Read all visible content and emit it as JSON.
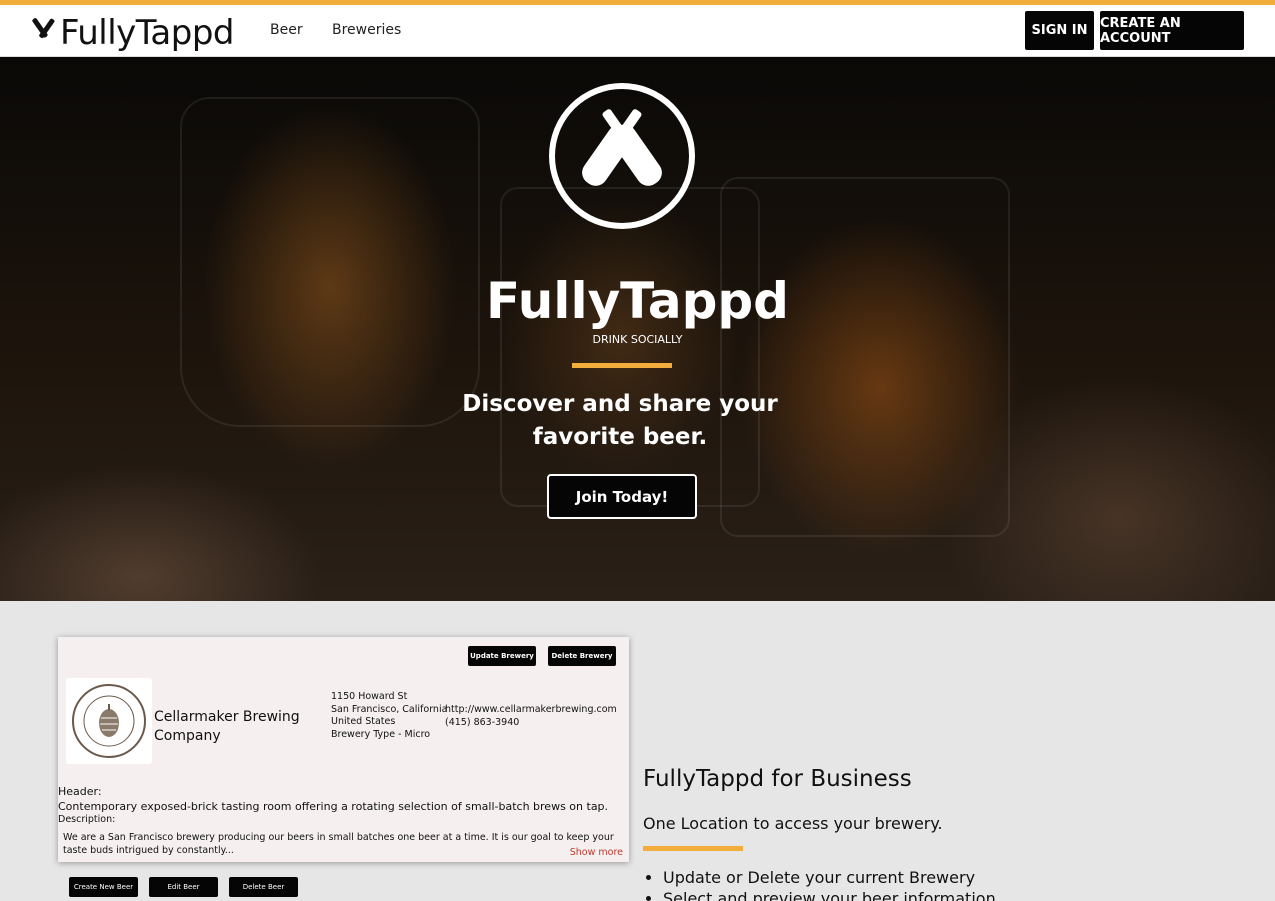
{
  "nav": {
    "brand": "FullyTappd",
    "links": [
      "Beer",
      "Breweries"
    ],
    "sign_in": "SIGN IN",
    "create_account": "CREATE AN ACCOUNT",
    "accent": "#f2ad3c"
  },
  "hero": {
    "logo_icon": "crossed-bottles-icon",
    "title": "FullyTappd",
    "tagline": "DRINK SOCIALLY",
    "lead": "Discover and share your favorite beer.",
    "cta": "Join Today!"
  },
  "preview": {
    "buttons_top": [
      "Update Brewery",
      "Delete Brewery"
    ],
    "brewery_name": "Cellarmaker Brewing Company",
    "logo_text": "CELLARMAKER",
    "logo_subtext": "BREWING COMPANY",
    "address_lines": [
      "1150 Howard St",
      "San Francisco, California",
      "United States",
      "Brewery Type - Micro"
    ],
    "website": "http://www.cellarmakerbrewing.com",
    "phone": "(415) 863-3940",
    "header_label": "Header:",
    "header_text": "Contemporary exposed-brick tasting room offering a rotating selection of small-batch brews on tap.",
    "description_label": "Description:",
    "description_text": "We are a San Francisco brewery producing our beers in small batches one beer at a time. It is our goal to keep your taste buds intrigued by constantly...",
    "show_more": "Show more",
    "buttons_bottom": [
      "Create New Beer",
      "Edit Beer",
      "Delete Beer"
    ]
  },
  "business": {
    "title": "FullyTappd for Business",
    "subtitle": "One Location to access your brewery.",
    "features": [
      "Update or Delete your current Brewery",
      "Select and preview your beer information"
    ]
  }
}
